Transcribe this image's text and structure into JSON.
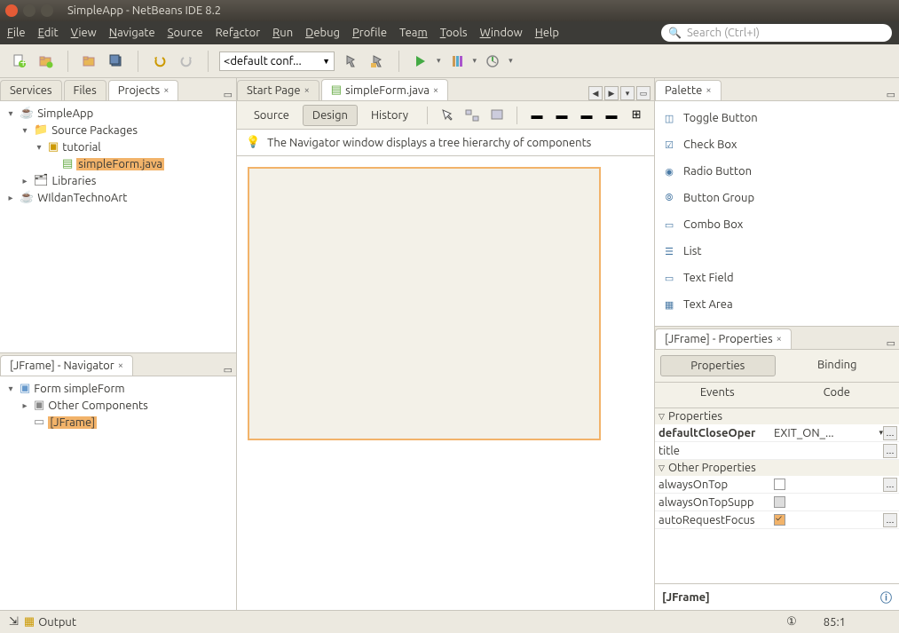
{
  "window": {
    "title": "SimpleApp - NetBeans IDE 8.2"
  },
  "menu": {
    "items": [
      "File",
      "Edit",
      "View",
      "Navigate",
      "Source",
      "Refactor",
      "Run",
      "Debug",
      "Profile",
      "Team",
      "Tools",
      "Window",
      "Help"
    ],
    "search_placeholder": "Search (Ctrl+I)"
  },
  "toolbar": {
    "config": "<default conf..."
  },
  "leftTabs": {
    "services": "Services",
    "files": "Files",
    "projects": "Projects"
  },
  "projectTree": {
    "root1": "SimpleApp",
    "srcpkg": "Source Packages",
    "tutorial": "tutorial",
    "file": "simpleForm.java",
    "libs": "Libraries",
    "root2": "WIldanTechnoArt"
  },
  "navigator": {
    "title": "[JFrame] - Navigator",
    "form": "Form simpleForm",
    "other": "Other Components",
    "jframe": "[JFrame]"
  },
  "editorTabs": {
    "start": "Start Page",
    "form": "simpleForm.java"
  },
  "designBar": {
    "source": "Source",
    "design": "Design",
    "history": "History"
  },
  "hint": "The Navigator window displays a tree hierarchy of components",
  "palette": {
    "title": "Palette",
    "items": [
      "Toggle Button",
      "Check Box",
      "Radio Button",
      "Button Group",
      "Combo Box",
      "List",
      "Text Field",
      "Text Area"
    ]
  },
  "properties": {
    "title": "[JFrame] - Properties",
    "tabs": {
      "properties": "Properties",
      "binding": "Binding",
      "events": "Events",
      "code": "Code"
    },
    "cat1": "Properties",
    "rows1": [
      {
        "k": "defaultCloseOper",
        "v": "EXIT_ON_...",
        "bold": true,
        "dd": true
      },
      {
        "k": "title",
        "v": ""
      }
    ],
    "cat2": "Other Properties",
    "rows2": [
      {
        "k": "alwaysOnTop",
        "v": "",
        "chk": false
      },
      {
        "k": "alwaysOnTopSupp",
        "v": "",
        "chk": false,
        "dis": true
      },
      {
        "k": "autoRequestFocus",
        "v": "",
        "chk": true
      }
    ],
    "footer": "[JFrame]"
  },
  "status": {
    "output": "Output",
    "pos": "85:1",
    "ins": "1"
  }
}
